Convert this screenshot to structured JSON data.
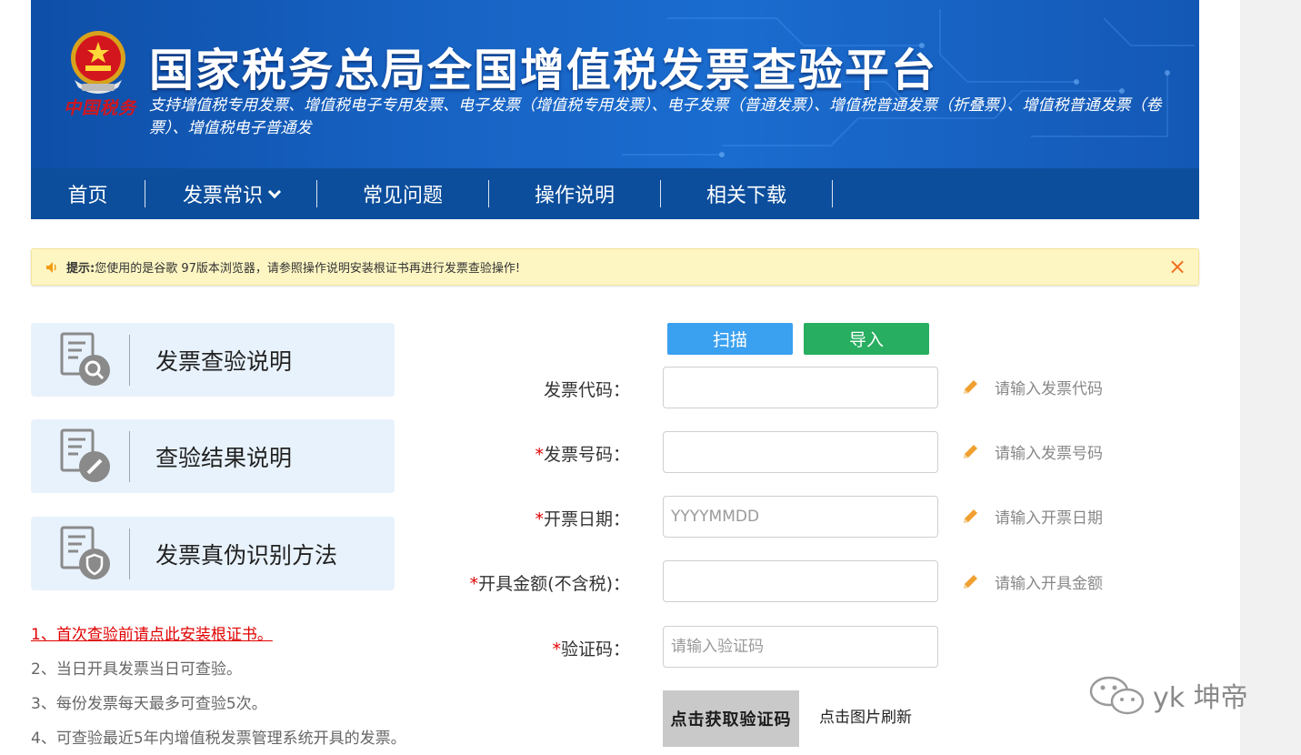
{
  "header": {
    "title": "国家税务总局全国增值税发票查验平台",
    "subtitle": "支持增值税专用发票、增值税电子专用发票、电子发票（增值税专用发票）、电子发票（普通发票）、增值税普通发票（折叠票）、增值税普通发票（卷票）、增值税电子普通发",
    "seal_text": "中国税务"
  },
  "nav": {
    "items": [
      "首页",
      "发票常识",
      "常见问题",
      "操作说明",
      "相关下载"
    ]
  },
  "notice": {
    "label": "提示:",
    "text": "您使用的是谷歌 97版本浏览器，请参照操作说明安装根证书再进行发票查验操作!",
    "close": "×"
  },
  "cards": [
    "发票查验说明",
    "查验结果说明",
    "发票真伪识别方法"
  ],
  "tips": [
    "1、首次查验前请点此安装根证书。",
    "2、当日开具发票当日可查验。",
    "3、每份发票每天最多可查验5次。",
    "4、可查验最近5年内增值税发票管理系统开具的发票。"
  ],
  "buttons": {
    "scan": "扫描",
    "import": "导入"
  },
  "form": {
    "required_mark": "*",
    "fields": [
      {
        "label": "发票代码：",
        "required": false,
        "placeholder": "",
        "hint": "请输入发票代码"
      },
      {
        "label": "发票号码：",
        "required": true,
        "placeholder": "",
        "hint": "请输入发票号码"
      },
      {
        "label": "开票日期：",
        "required": true,
        "placeholder": "YYYYMMDD",
        "hint": "请输入开票日期"
      },
      {
        "label": "开具金额(不含税)：",
        "required": true,
        "placeholder": "",
        "hint": "请输入开具金额"
      },
      {
        "label": "验证码：",
        "required": true,
        "placeholder": "请输入验证码",
        "hint": ""
      }
    ],
    "captcha_text": "点击获取验证码",
    "refresh_text": "点击图片刷新"
  },
  "watermark": "yk 坤帝",
  "colors": {
    "nav_bg": "#0c4e9c",
    "scan_btn": "#3aa0f0",
    "import_btn": "#27ae60",
    "notice_bg": "#fdf6c3",
    "required": "#e00000"
  }
}
